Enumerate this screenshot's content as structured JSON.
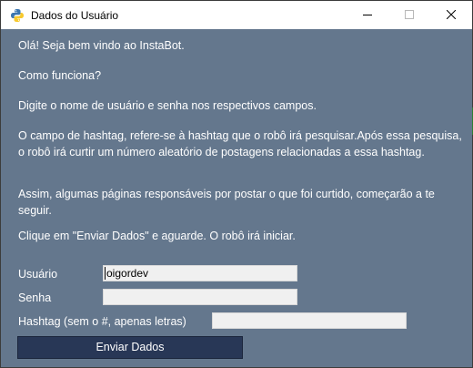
{
  "window": {
    "title": "Dados do Usuário",
    "icon": "python-icon",
    "controls": [
      "minimize-icon",
      "maximize-icon",
      "close-icon"
    ]
  },
  "intro": {
    "greeting": "Olá! Seja bem vindo ao InstaBot.",
    "how_title": "Como funciona?",
    "step1": "Digite o nome de usuário e senha nos respectivos campos.",
    "step2": "O campo de hashtag, refere-se à hashtag que o robô irá pesquisar.Após essa pesquisa, o robô irá curtir um número aleatório de postagens relacionadas a essa hashtag.",
    "step3": "Assim, algumas páginas responsáveis por postar o que foi curtido, começarão a te seguir.",
    "step4": "Clique em \"Enviar Dados\" e aguarde. O robô irá iniciar."
  },
  "form": {
    "username_label": "Usuário",
    "username_value": "oigordev",
    "password_label": "Senha",
    "password_value": "",
    "hashtag_label": "Hashtag (sem o #, apenas letras)",
    "hashtag_value": "",
    "submit_label": "Enviar Dados"
  },
  "colors": {
    "window_bg": "#64778d",
    "button_bg": "#283756",
    "field_bg": "#f0f0f0"
  }
}
